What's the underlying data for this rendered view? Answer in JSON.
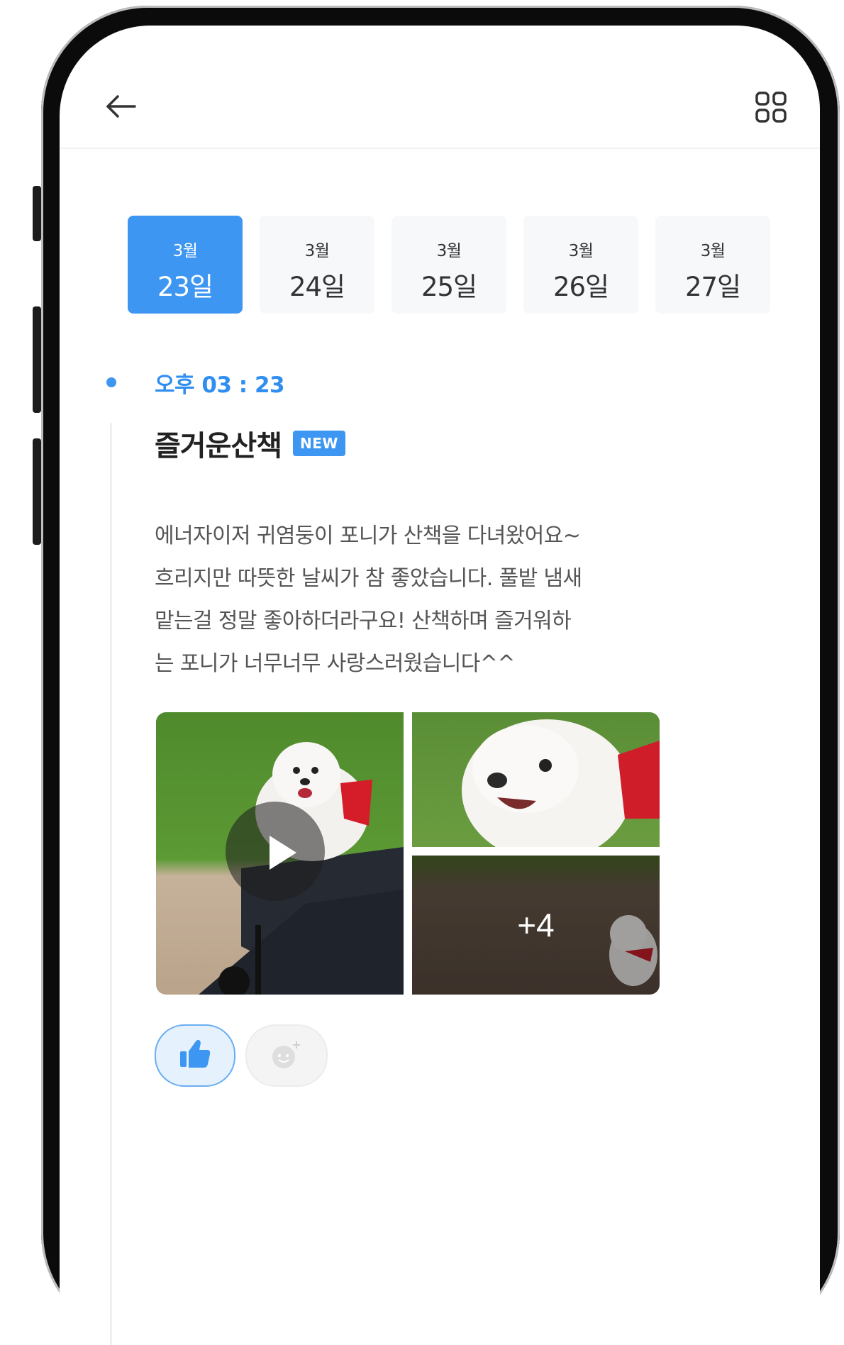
{
  "header": {
    "back_icon": "arrow-left-icon",
    "grid_icon": "grid-icon"
  },
  "dates": [
    {
      "month": "3월",
      "day": "23일",
      "active": true
    },
    {
      "month": "3월",
      "day": "24일",
      "active": false
    },
    {
      "month": "3월",
      "day": "25일",
      "active": false
    },
    {
      "month": "3월",
      "day": "26일",
      "active": false
    },
    {
      "month": "3월",
      "day": "27일",
      "active": false
    }
  ],
  "post": {
    "time": "오후 03 : 23",
    "title": "즐거운산책",
    "badge": "NEW",
    "body_lines": [
      "에너자이저 귀염둥이 포니가 산책을 다녀왔어요~",
      "흐리지만 따뜻한 날씨가 참 좋았습니다. 풀밭 냄새",
      "맡는걸 정말 좋아하더라구요! 산책하며 즐거워하",
      "는 포니가 너무너무 사랑스러웠습니다^^"
    ],
    "more_photos": "+4"
  },
  "reactions": {
    "like_icon": "thumbs-up-icon",
    "emoji_icon": "add-emoji-icon"
  },
  "colors": {
    "accent": "#3d96f2",
    "time_text": "#2f8ef0",
    "date_inactive_bg": "#f7f8fa"
  }
}
